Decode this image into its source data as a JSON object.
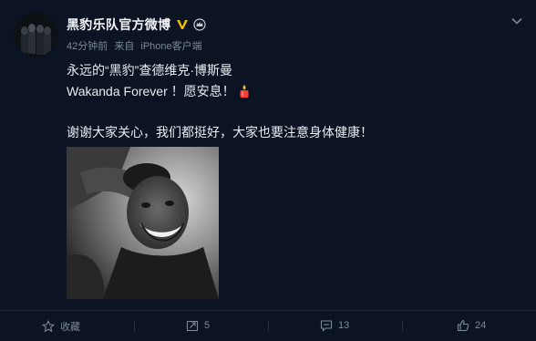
{
  "post": {
    "author": "黑豹乐队官方微博",
    "time": "42分钟前",
    "source_prefix": "来自",
    "source": "iPhone客户端",
    "line1": "永远的“黑豹”查德维克·博斯曼",
    "line2": "Wakanda Forever ！愿安息！",
    "line3": "谢谢大家关心，我们都挺好，大家也要注意身体健康！"
  },
  "actions": {
    "favorite_label": "收藏",
    "repost_count": "5",
    "comment_count": "13",
    "like_count": "24"
  },
  "colors": {
    "background": "#0c1423",
    "verified_badge": "#f5b800",
    "candle_flame": "#ff3b30"
  },
  "icons": [
    "verified-v-icon",
    "crown-icon",
    "chevron-down-icon",
    "candle-icon",
    "star-icon",
    "repost-icon",
    "comment-icon",
    "like-icon"
  ]
}
